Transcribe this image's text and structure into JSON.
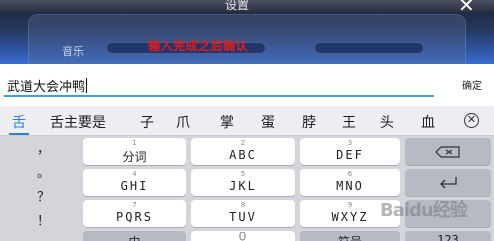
{
  "background": {
    "title": "设置",
    "close": "✕",
    "label": "音乐"
  },
  "annotation": "输入完成之后确认",
  "input": {
    "value": "武道大会冲鸭",
    "confirm_label": "确定"
  },
  "candidates": [
    "舌",
    "舌主要是",
    "子",
    "爪",
    "掌",
    "蛋",
    "脖",
    "王",
    "头",
    "血"
  ],
  "punctuation": [
    "，",
    "。",
    "？",
    "！"
  ],
  "keys": {
    "row1": [
      {
        "num": "1",
        "label": "分词"
      },
      {
        "num": "2",
        "label": "ABC"
      },
      {
        "num": "3",
        "label": "DEF"
      }
    ],
    "row2": [
      {
        "num": "4",
        "label": "GHI"
      },
      {
        "num": "5",
        "label": "JKL"
      },
      {
        "num": "6",
        "label": "MNO"
      }
    ],
    "row3": [
      {
        "num": "7",
        "label": "PQRS"
      },
      {
        "num": "8",
        "label": "TUV"
      },
      {
        "num": "9",
        "label": "WXYZ"
      }
    ],
    "row4": {
      "left": "中",
      "mid": "符号",
      "right": "123"
    }
  },
  "watermark": "Baidu经验",
  "colors": {
    "accent": "#2b7fd6",
    "underline": "#3e9cd6",
    "annotation": "#e41b1b"
  }
}
